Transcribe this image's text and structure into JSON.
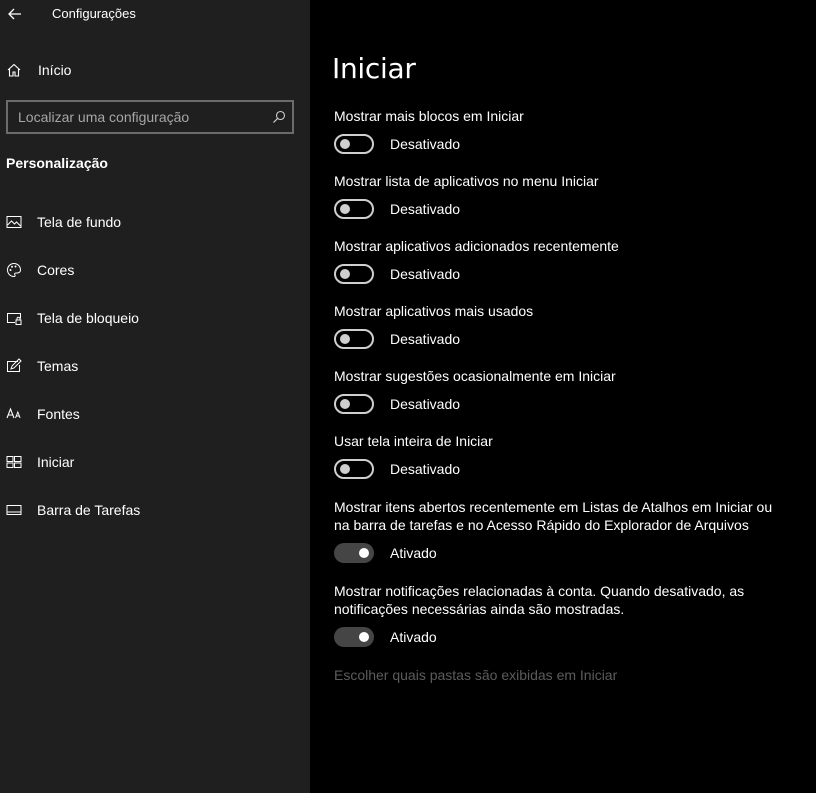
{
  "app": {
    "title": "Configurações"
  },
  "sidebar": {
    "home_label": "Início",
    "search": {
      "placeholder": "Localizar uma configuração"
    },
    "section_title": "Personalização",
    "items": [
      {
        "label": "Tela de fundo",
        "icon": "image-icon"
      },
      {
        "label": "Cores",
        "icon": "palette-icon"
      },
      {
        "label": "Tela de bloqueio",
        "icon": "lock-screen-icon"
      },
      {
        "label": "Temas",
        "icon": "themes-icon"
      },
      {
        "label": "Fontes",
        "icon": "fonts-icon"
      },
      {
        "label": "Iniciar",
        "icon": "start-icon"
      },
      {
        "label": "Barra de Tarefas",
        "icon": "taskbar-icon"
      }
    ]
  },
  "main": {
    "title": "Iniciar",
    "settings": [
      {
        "desc": "Mostrar mais blocos em Iniciar",
        "state_label": "Desativado",
        "on": false
      },
      {
        "desc": "Mostrar lista de aplicativos no menu Iniciar",
        "state_label": "Desativado",
        "on": false
      },
      {
        "desc": "Mostrar aplicativos adicionados recentemente",
        "state_label": "Desativado",
        "on": false
      },
      {
        "desc": "Mostrar aplicativos mais usados",
        "state_label": "Desativado",
        "on": false
      },
      {
        "desc": "Mostrar sugestões ocasionalmente em Iniciar",
        "state_label": "Desativado",
        "on": false
      },
      {
        "desc": "Usar tela inteira de Iniciar",
        "state_label": "Desativado",
        "on": false
      },
      {
        "desc": "Mostrar itens abertos recentemente em Listas de Atalhos em Iniciar ou na barra de tarefas e no Acesso Rápido do Explorador de Arquivos",
        "state_label": "Ativado",
        "on": true
      },
      {
        "desc": "Mostrar notificações relacionadas à conta. Quando desativado, as notificações necessárias ainda são mostradas.",
        "state_label": "Ativado",
        "on": true
      }
    ],
    "folders_link": "Escolher quais pastas são exibidas em Iniciar"
  },
  "colors": {
    "sidebar_bg": "#1f1f1f",
    "main_bg": "#000000",
    "toggle_on_track": "#454545",
    "disabled_link": "#5c5c5c"
  }
}
